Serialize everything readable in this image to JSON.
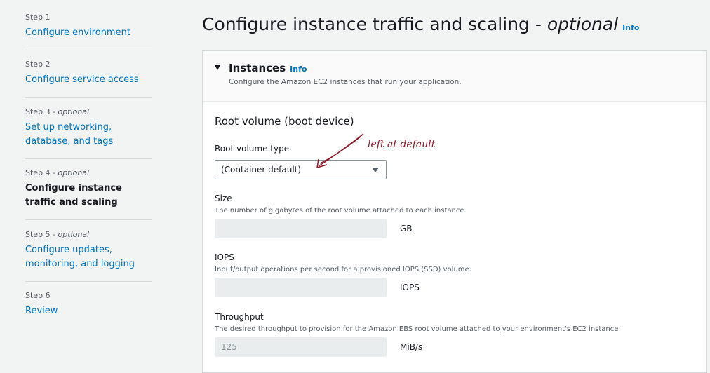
{
  "steps": [
    {
      "label": "Step 1",
      "optional": "",
      "title": "Configure environment",
      "current": false
    },
    {
      "label": "Step 2",
      "optional": "",
      "title": "Configure service access",
      "current": false
    },
    {
      "label": "Step 3 - ",
      "optional": "optional",
      "title": "Set up networking, database, and tags",
      "current": false
    },
    {
      "label": "Step 4 - ",
      "optional": "optional",
      "title": "Configure instance traffic and scaling",
      "current": true
    },
    {
      "label": "Step 5 - ",
      "optional": "optional",
      "title": "Configure updates, monitoring, and logging",
      "current": false
    },
    {
      "label": "Step 6",
      "optional": "",
      "title": "Review",
      "current": false
    }
  ],
  "page": {
    "title": "Configure instance traffic and scaling - ",
    "title_optional": "optional",
    "info": "Info"
  },
  "instances": {
    "title": "Instances",
    "info": "Info",
    "description": "Configure the Amazon EC2 instances that run your application."
  },
  "root_volume": {
    "heading": "Root volume (boot device)",
    "type_label": "Root volume type",
    "type_value": "(Container default)",
    "size_label": "Size",
    "size_desc": "The number of gigabytes of the root volume attached to each instance.",
    "size_value": "",
    "size_unit": "GB",
    "iops_label": "IOPS",
    "iops_desc": "Input/output operations per second for a provisioned IOPS (SSD) volume.",
    "iops_value": "",
    "iops_unit": "IOPS",
    "throughput_label": "Throughput",
    "throughput_desc": "The desired throughput to provision for the Amazon EBS root volume attached to your environment's EC2 instance",
    "throughput_value": "125",
    "throughput_unit": "MiB/s"
  },
  "annotation": "left at default",
  "colors": {
    "link": "#0073bb",
    "annotation": "#8b1a2b"
  }
}
